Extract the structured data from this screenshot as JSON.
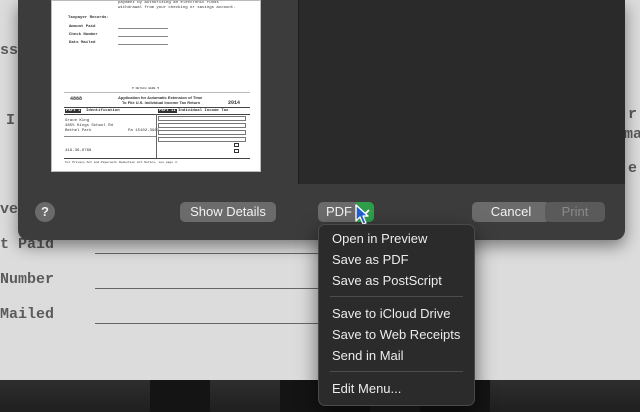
{
  "background_document": {
    "lines": [
      "ss",
      "I",
      "ve",
      "t Paid",
      "Number",
      "Mailed",
      "r",
      "ma",
      "e"
    ]
  },
  "preview": {
    "header_line1": "payment by authorizing an electronic funds",
    "header_line2": "withdrawal from your checking or savings account.",
    "records_title": "Taxpayer Records:",
    "record_labels": [
      "Amount Paid",
      "Check Number",
      "Date Mailed"
    ],
    "detach_text": "▼ DETACH HERE ▼",
    "form_number": "4868",
    "form_title_1": "Application for Automatic Extension of Time",
    "form_title_2": "To File U.S. Individual Income Tax Return",
    "form_year": "2014",
    "part1": "Part I",
    "part1_title": "Identification",
    "part2": "Part II",
    "part2_title": "Individual Income Tax",
    "name": "Grace King",
    "address": "4855 Kings School Rd",
    "city": "Bethel Park",
    "state_zip": "Pa   15102-3963",
    "ssn": "419-36-0768",
    "footer": "For Privacy Act and Paperwork Reduction Act Notice, see page 4."
  },
  "dialog": {
    "help_label": "?",
    "show_details_label": "Show Details",
    "pdf_label": "PDF",
    "cancel_label": "Cancel",
    "print_label": "Print"
  },
  "pdf_menu": {
    "items": [
      "Open in Preview",
      "Save as PDF",
      "Save as PostScript",
      "Save to iCloud Drive",
      "Save to Web Receipts",
      "Send in Mail",
      "Edit Menu..."
    ]
  },
  "colors": {
    "sheet_bg": "#3c3c3c",
    "menu_bg": "#2b2b2b",
    "button_bg": "#6b6b6b",
    "accent_green": "#2f9e4a",
    "cursor_blue": "#1f5fd6"
  },
  "icons": [
    "chevron-down-icon",
    "pointer-cursor-icon"
  ]
}
